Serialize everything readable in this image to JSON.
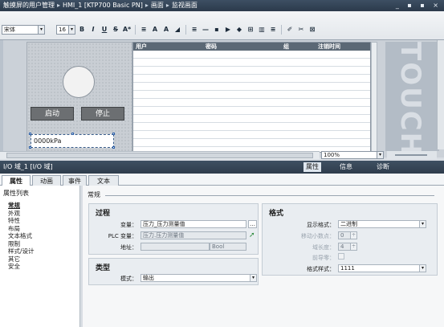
{
  "titlebar": {
    "crumbs": [
      "触摸屏的用户管理",
      "HMI_1 [KTP700 Basic PN]",
      "画面",
      "监视画面"
    ],
    "controls": "_ ▪ ▪ ×"
  },
  "toolbar": {
    "font": "宋体",
    "size": "16",
    "buttons": [
      "B",
      "I",
      "U",
      "S",
      "A*",
      "≡",
      "A",
      "A",
      "◢",
      "≡",
      "—",
      "▪",
      "▶",
      "◆",
      "⊞",
      "▥",
      "≡",
      "✐",
      "✂",
      "⊠"
    ]
  },
  "canvas": {
    "start_label": "启动",
    "stop_label": "停止",
    "io_value": "0000kPa",
    "touch_text": "TOUCH"
  },
  "user_table": {
    "columns": [
      "用户",
      "密码",
      "组",
      "注销时间"
    ]
  },
  "zoom": {
    "value": "100%"
  },
  "inspector": {
    "title": "I/O 域_1 [I/O 域]",
    "right_tabs": [
      "属性",
      "信息",
      "诊断"
    ],
    "tabs": [
      "属性",
      "动画",
      "事件",
      "文本"
    ],
    "nav_head": "属性列表",
    "nav_items": [
      "常规",
      "外观",
      "特性",
      "布局",
      "文本格式",
      "限制",
      "样式/设计",
      "其它",
      "安全"
    ],
    "category": "常规",
    "process": {
      "title": "过程",
      "var_label": "变量：",
      "var_value": "压力_压力测量值",
      "plc_label": "PLC 变量：",
      "plc_value": "压力.压力测量值",
      "addr_label": "地址：",
      "addr_type": "Bool"
    },
    "type": {
      "title": "类型",
      "mode_label": "模式：",
      "mode_value": "输出"
    },
    "format": {
      "title": "格式",
      "display_label": "显示格式：",
      "display_value": "二进制",
      "decimals_label": "移动小数点：",
      "decimals_value": "0",
      "length_label": "域长度：",
      "length_value": "4",
      "leading_label": "前导零：",
      "pattern_label": "格式样式：",
      "pattern_value": "1111"
    }
  }
}
